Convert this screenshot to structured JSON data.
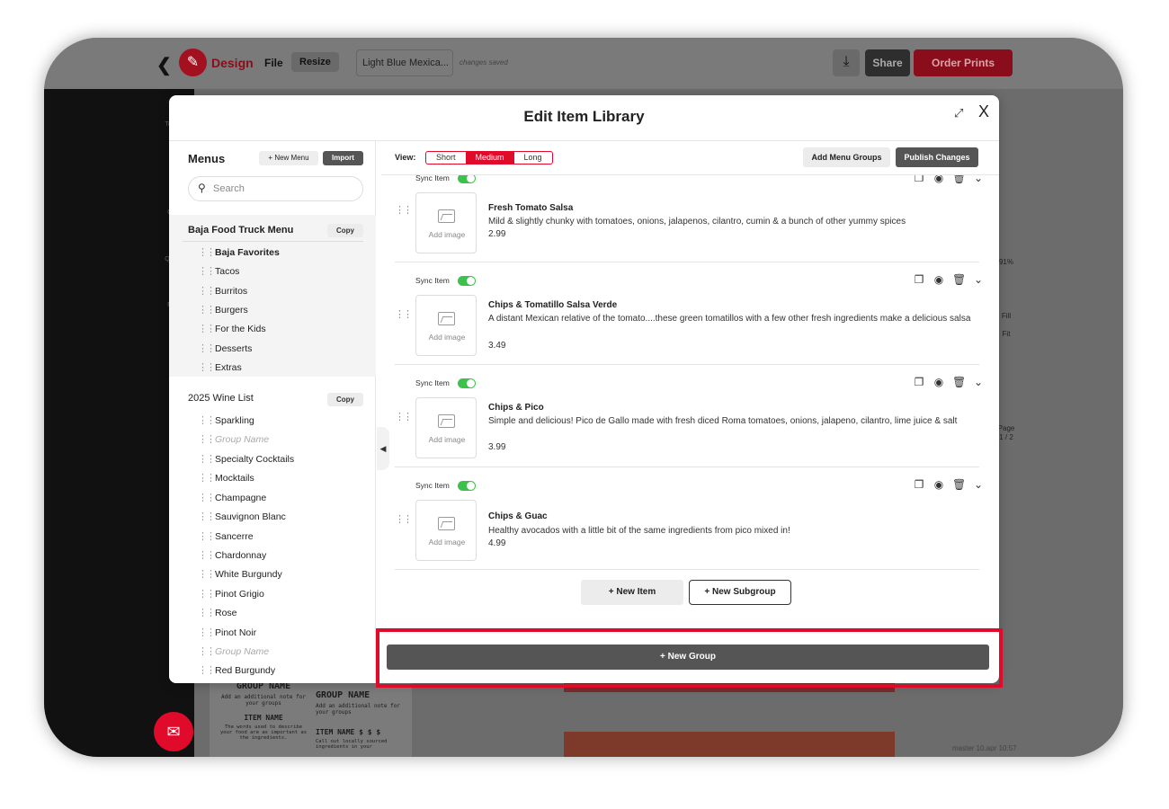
{
  "app": {
    "back": "❮",
    "logo": "✎",
    "design": "Design",
    "file": "File",
    "resize": "Resize",
    "doc_name": "Light Blue Mexica...",
    "saved": "changes saved",
    "download": "⤓",
    "share": "Share",
    "order_prints": "Order Prints",
    "rail": [
      "Temp",
      "Gra",
      "QR C",
      "Fav"
    ],
    "right_rail": [
      "91%",
      "Fill",
      "Fit",
      "Page",
      "1 / 2"
    ],
    "master": "master 10.apr 10:57",
    "bg_menu": {
      "group_name_1": "GROUP NAME",
      "note_1": "Add an additional note for your groups",
      "item_name_1": "ITEM NAME",
      "desc_1": "The words used to describe your food are as important as the ingredients.",
      "group_name_2": "GROUP NAME",
      "note_2": "Add an additional note for your groups",
      "item_name_2": "ITEM NAME $ $ $",
      "desc_2": "Call out locally sourced ingredients in your"
    }
  },
  "modal": {
    "title": "Edit Item Library",
    "expand_icon": "⤢",
    "close_icon": "X"
  },
  "sidebar": {
    "heading": "Menus",
    "new_menu": "+ New Menu",
    "import": "Import",
    "search_placeholder": "Search",
    "menus": [
      {
        "name": "Baja Food Truck Menu",
        "copy": "Copy",
        "groups": [
          "Baja Favorites",
          "Tacos",
          "Burritos",
          "Burgers",
          "For the Kids",
          "Desserts",
          "Extras"
        ]
      },
      {
        "name": "2025 Wine List",
        "copy": "Copy",
        "groups": [
          "Sparkling",
          "Group Name",
          "Specialty Cocktails",
          "Mocktails",
          "Champagne",
          "Sauvignon Blanc",
          "Sancerre",
          "Chardonnay",
          "White Burgundy",
          "Pinot Grigio",
          "Rose",
          "Pinot Noir",
          "Group Name",
          "Red Burgundy"
        ]
      }
    ],
    "collapse": "◀"
  },
  "main": {
    "view_label": "View:",
    "view_options": [
      "Short",
      "Medium",
      "Long"
    ],
    "view_selected": "Medium",
    "add_menu_groups": "Add Menu Groups",
    "publish_changes": "Publish Changes",
    "sync_label": "Sync Item",
    "add_image": "Add image",
    "items": [
      {
        "name": "Fresh Tomato Salsa",
        "desc": "Mild & slightly chunky with tomatoes, onions, jalapenos, cilantro, cumin & a bunch of other yummy spices",
        "price": "2.99",
        "sync": true
      },
      {
        "name": "Chips & Tomatillo Salsa Verde",
        "desc": "A distant Mexican relative of the tomato....these green tomatillos with a few other fresh ingredients make a delicious salsa",
        "price": "3.49",
        "sync": true
      },
      {
        "name": "Chips & Pico",
        "desc": "Simple and delicious! Pico de Gallo made with fresh diced Roma tomatoes, onions, jalapeno, cilantro, lime juice & salt",
        "price": "3.99",
        "sync": true
      },
      {
        "name": "Chips & Guac",
        "desc": "Healthy avocados with a little bit of the same ingredients from pico mixed in!",
        "price": "4.99",
        "sync": true
      }
    ],
    "new_item": "+ New Item",
    "new_subgroup": "+ New Subgroup",
    "new_group": "+ New Group"
  },
  "colors": {
    "accent": "#e00b2b",
    "toggle_on": "#3cc24a",
    "dark_button": "#555555"
  }
}
